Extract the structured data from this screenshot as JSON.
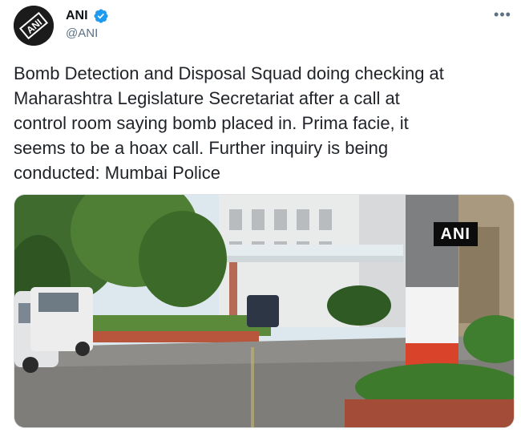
{
  "author": {
    "name": "ANI",
    "handle": "@ANI",
    "avatar_text": "ANI",
    "avatar_icon": "ani-logo-icon",
    "verified_icon": "verified-badge-icon"
  },
  "more_icon": "more-options-icon",
  "tweet": {
    "text": "Bomb Detection and Disposal Squad doing checking at\nMaharashtra Legislature Secretariat after a call at\ncontrol room saying bomb placed in. Prima facie, it\nseems to be a hoax call. Further inquiry is being\nconducted: Mumbai Police"
  },
  "media": {
    "watermark": "ANI"
  },
  "colors": {
    "verified_blue": "#1d9bf0",
    "text": "#1f2328",
    "secondary": "#5b7083"
  }
}
